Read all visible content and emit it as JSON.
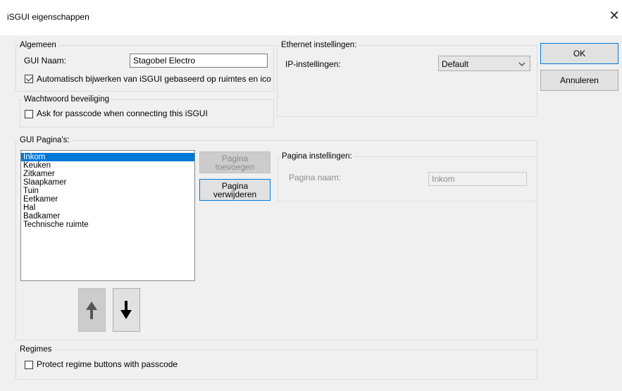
{
  "window": {
    "title": "iSGUI eigenschappen",
    "close_glyph": "✕"
  },
  "algemeen": {
    "legend": "Algemeen",
    "gui_naam_label": "GUI Naam:",
    "gui_naam_value": "Stagobel Electro",
    "auto_update_label": "Automatisch bijwerken van iSGUI gebaseerd op ruimtes en ico",
    "auto_update_checked": true
  },
  "ethernet": {
    "legend": "Ethernet instellingen:",
    "ip_label": "IP-instellingen:",
    "ip_value": "Default"
  },
  "wachtwoord": {
    "legend": "Wachtwoord beveiliging",
    "passcode_label": "Ask for passcode when connecting this iSGUI",
    "passcode_checked": false
  },
  "buttons": {
    "ok": "OK",
    "cancel": "Annuleren"
  },
  "pages": {
    "legend": "GUI Pagina's:",
    "items": [
      "Inkom",
      "Keuken",
      "Zitkamer",
      "Slaapkamer",
      "Tuin",
      "Eetkamer",
      "Hal",
      "Badkamer",
      "Technische ruimte"
    ],
    "selected": "Inkom",
    "add_line1": "Pagina",
    "add_line2": "toevoegen",
    "remove_line1": "Pagina",
    "remove_line2": "verwijderen",
    "settings_legend": "Pagina instellingen:",
    "page_name_label": "Pagina naam:",
    "page_name_value": "Inkom"
  },
  "regimes": {
    "legend": "Regimes",
    "protect_label": "Protect regime buttons with passcode",
    "protect_checked": false
  },
  "icons": {
    "up": "arrow-up-icon",
    "down": "arrow-down-icon",
    "chevron": "chevron-down-icon",
    "check": "checkmark-icon"
  },
  "colors": {
    "selection": "#0078d7",
    "background": "#f0f0f0",
    "primary_border": "#0078d7"
  }
}
